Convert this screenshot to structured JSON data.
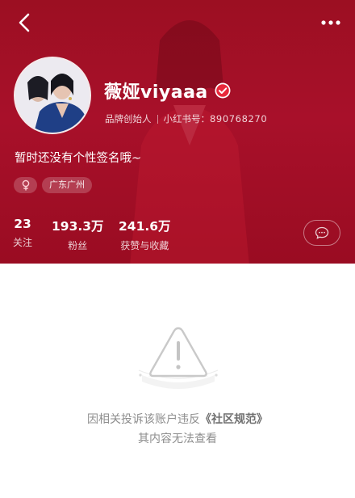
{
  "nav": {
    "back_icon": "chevron-left-icon",
    "more_icon": "more-dots-icon"
  },
  "profile": {
    "name": "薇娅viyaaa",
    "verified_icon": "verified-badge-icon",
    "role": "品牌创始人",
    "id_label": "小红书号：",
    "id_value": "890768270",
    "bio": "暂时还没有个性签名哦~",
    "gender_icon": "female-icon",
    "location": "广东广州"
  },
  "stats": [
    {
      "value": "23",
      "label": "关注"
    },
    {
      "value": "193.3万",
      "label": "粉丝"
    },
    {
      "value": "241.6万",
      "label": "获赞与收藏"
    }
  ],
  "message_icon": "chat-bubble-icon",
  "notice": {
    "line1_prefix": "因相关投诉该账户违反",
    "line1_bold": "《社区规范》",
    "line2": "其内容无法查看",
    "icon": "warning-triangle-icon"
  },
  "colors": {
    "header_red": "#a8102a",
    "verified_red": "#e8293b",
    "notice_gray": "#8e8e8e"
  }
}
